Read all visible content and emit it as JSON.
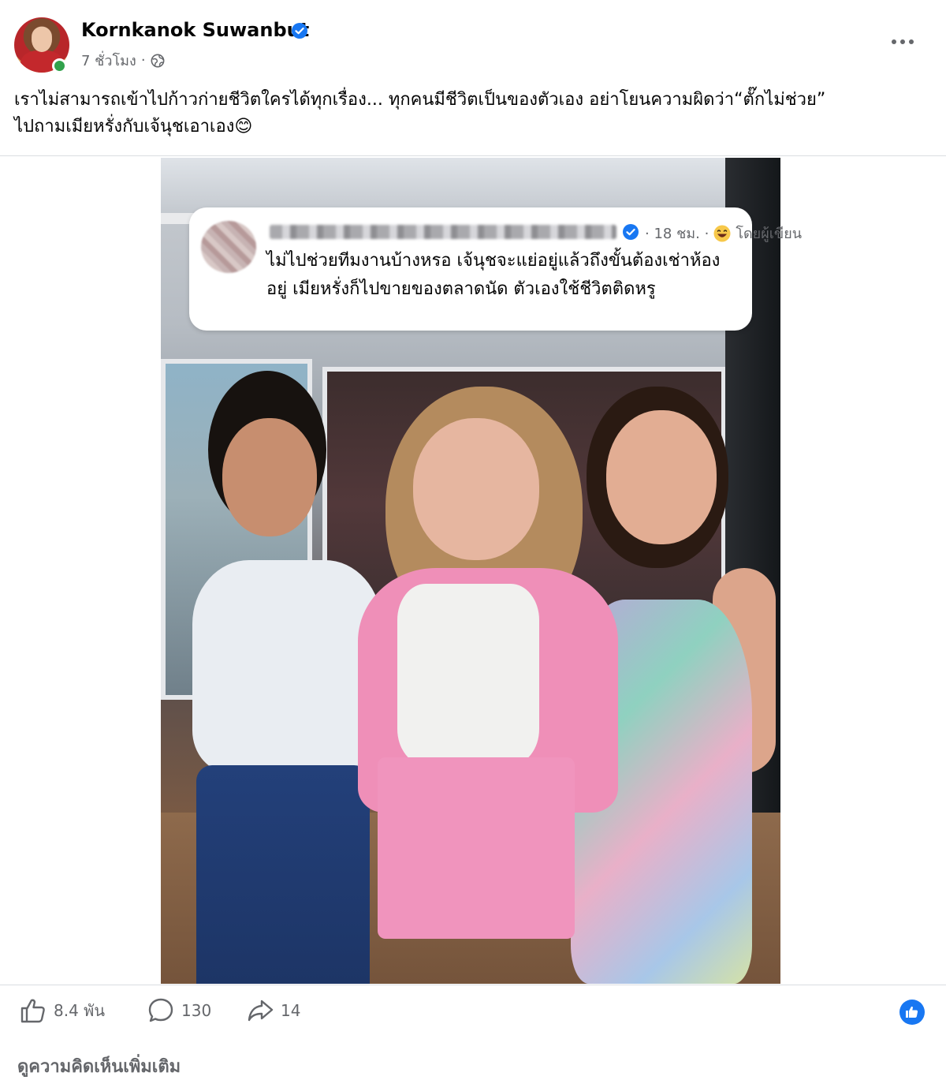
{
  "post": {
    "author": "Kornkanok Suwanbut",
    "time": "7 ชั่วโมง",
    "separator": "·",
    "text_line1": "เราไม่สามารถเข้าไปก้าวก่ายชีวิตใครได้ทุกเรื่อง... ทุกคนมีชีวิตเป็นของตัวเอง อย่าโยนความผิดว่า“ตั๊กไม่ช่วย”",
    "text_line2": "ไปถามเมียหรั่งกับเจ้นุชเอาเอง😊"
  },
  "comment": {
    "time": "· 18 ชม. ·",
    "label": "โดยผู้เขียน",
    "text": "ไม่ไปช่วยทีมงานบ้างหรอ  เจ้นุชจะแย่อยู่แล้วถึงขั้นต้องเช่าห้องอยู่  เมียหรั่งก็ไปขายของตลาดนัด  ตัวเองใช้ชีวิตติดหรู"
  },
  "actions": {
    "likes": "8.4 พัน",
    "comments": "130",
    "shares": "14"
  },
  "footer": {
    "more_comments": "ดูความคิดเห็นเพิ่มเติม"
  },
  "colors": {
    "accent": "#1877f2",
    "secondary_text": "#65676b",
    "online": "#31a24c"
  },
  "icons": [
    "verified-badge-icon",
    "globe-icon",
    "more-options-icon",
    "laugh-emoji-icon",
    "like-icon",
    "comment-icon",
    "share-icon",
    "like-reaction-icon"
  ]
}
